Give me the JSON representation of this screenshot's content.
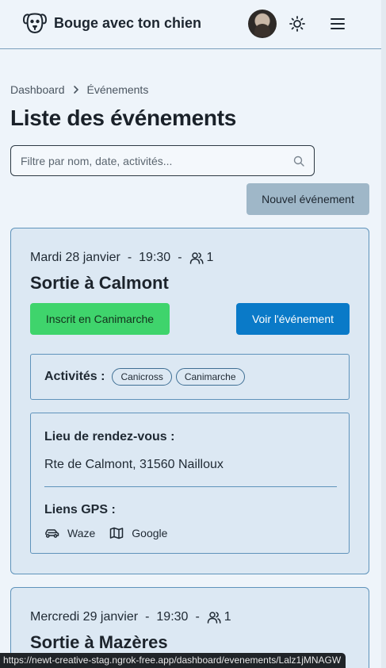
{
  "header": {
    "app_title": "Bouge avec ton chien",
    "logo_icon": "dog-icon",
    "theme_icon": "sun-icon",
    "menu_icon": "hamburger-icon"
  },
  "breadcrumb": {
    "items": [
      "Dashboard",
      "Événements"
    ]
  },
  "page": {
    "title": "Liste des événements"
  },
  "search": {
    "placeholder": "Filtre par nom, date, activités...",
    "value": ""
  },
  "actions": {
    "new_event_label": "Nouvel événement"
  },
  "events": [
    {
      "date": "Mardi 28 janvier",
      "time": "19:30",
      "participants": "1",
      "title": "Sortie à Calmont",
      "register_label": "Inscrit en Canimarche",
      "view_label": "Voir l'événement",
      "activities_label": "Activités :",
      "activities": [
        "Canicross",
        "Canimarche"
      ],
      "meeting_label": "Lieu de rendez-vous :",
      "address": "Rte de Calmont, 31560 Nailloux",
      "gps_label": "Liens GPS :",
      "gps_links": [
        "Waze",
        "Google"
      ]
    },
    {
      "date": "Mercredi 29 janvier",
      "time": "19:30",
      "participants": "1",
      "title": "Sortie à Mazères"
    }
  ],
  "status_bar": {
    "url": "https://newt-creative-stag.ngrok-free.app/dashboard/evenements/Lalz1jMNAGW"
  },
  "colors": {
    "background": "#eef4fa",
    "card_background": "#dce8f3",
    "card_border": "#5f93bb",
    "register_button": "#3fd46c",
    "view_button": "#0a7ac8",
    "new_event_button": "#9fb7c8"
  }
}
